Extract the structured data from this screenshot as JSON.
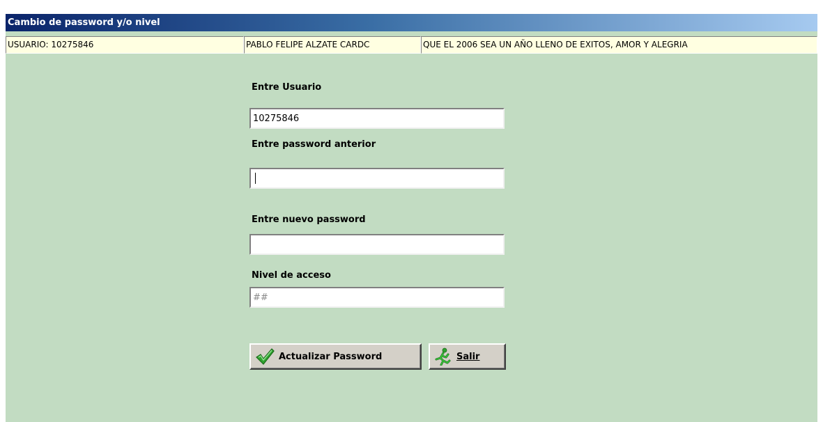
{
  "window": {
    "title": "Cambio de password y/o nivel"
  },
  "statusbar": {
    "user": "USUARIO: 10275846",
    "name": "PABLO FELIPE ALZATE CARDC",
    "message": "QUE EL 2006 SEA UN AÑO LLENO DE EXITOS, AMOR Y ALEGRIA"
  },
  "form": {
    "user_label": "Entre Usuario",
    "user_value": "10275846",
    "old_password_label": "Entre password anterior",
    "old_password_value": "",
    "new_password_label": "Entre nuevo password",
    "new_password_value": "",
    "access_level_label": "Nivel de acceso",
    "access_level_placeholder": "##"
  },
  "buttons": {
    "update_label": "Actualizar Password",
    "update_icon": "checkmark-icon",
    "exit_label": "Salir",
    "exit_icon": "running-man-icon"
  },
  "colors": {
    "background": "#c2dcc2",
    "status_background": "#ffffe1",
    "title_gradient_start": "#0a246a",
    "title_gradient_end": "#a6caf0"
  }
}
